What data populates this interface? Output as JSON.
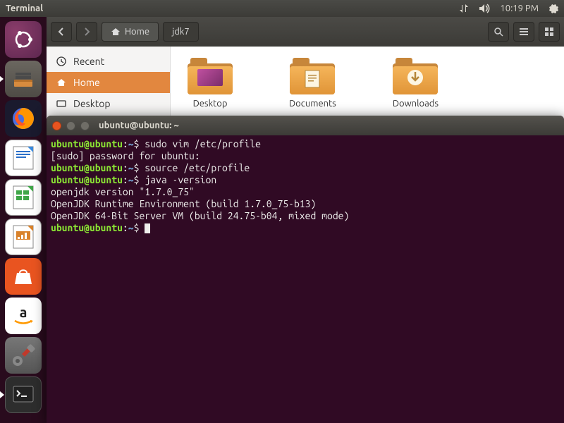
{
  "menubar": {
    "title": "Terminal",
    "time": "10:19 PM"
  },
  "launcher": {
    "items": [
      {
        "name": "dash",
        "label": "Ubuntu Dash"
      },
      {
        "name": "files",
        "label": "Files",
        "running": true
      },
      {
        "name": "firefox",
        "label": "Firefox"
      },
      {
        "name": "writer",
        "label": "LibreOffice Writer"
      },
      {
        "name": "calc",
        "label": "LibreOffice Calc"
      },
      {
        "name": "impress",
        "label": "LibreOffice Impress"
      },
      {
        "name": "software",
        "label": "Ubuntu Software"
      },
      {
        "name": "amazon",
        "label": "Amazon"
      },
      {
        "name": "settings",
        "label": "System Settings"
      },
      {
        "name": "terminal",
        "label": "Terminal",
        "running": true
      }
    ]
  },
  "files": {
    "path": {
      "home": "Home",
      "sub": "jdk7"
    },
    "sidebar": {
      "recent": "Recent",
      "home": "Home",
      "desktop": "Desktop"
    },
    "items": {
      "desktop": "Desktop",
      "documents": "Documents",
      "downloads": "Downloads"
    }
  },
  "terminal": {
    "title": "ubuntu@ubuntu: ~",
    "prompt": {
      "userhost": "ubuntu@ubuntu",
      "sep": ":",
      "path": "~",
      "sym": "$"
    },
    "lines": {
      "cmd1": "sudo vim /etc/profile",
      "sudo": "[sudo] password for ubuntu:",
      "cmd2": "source /etc/profile",
      "cmd3": "java -version",
      "out1": "openjdk version \"1.7.0_75\"",
      "out2": "OpenJDK Runtime Environment (build 1.7.0_75-b13)",
      "out3": "OpenJDK 64-Bit Server VM (build 24.75-b04, mixed mode)"
    }
  }
}
